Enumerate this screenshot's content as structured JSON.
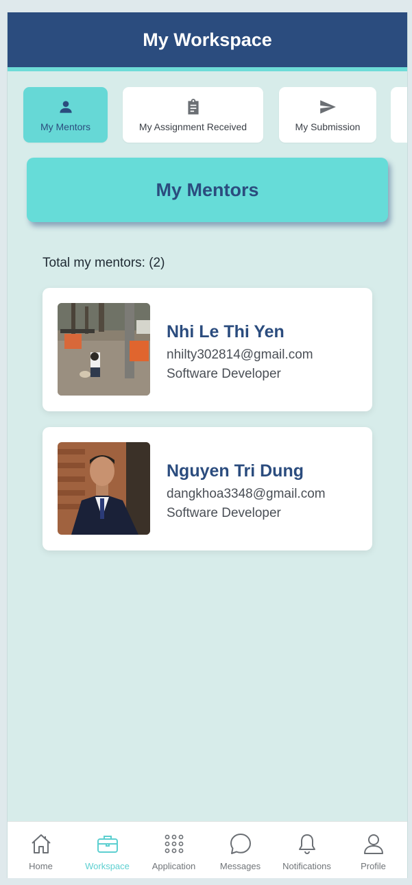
{
  "header": {
    "title": "My Workspace"
  },
  "tabs": [
    {
      "label": "My Mentors",
      "icon": "person-icon",
      "active": true
    },
    {
      "label": "My Assignment Received",
      "icon": "clipboard-icon",
      "active": false
    },
    {
      "label": "My Submission",
      "icon": "send-icon",
      "active": false
    }
  ],
  "section": {
    "title": "My Mentors"
  },
  "total": {
    "text": "Total my mentors: (2)"
  },
  "mentors": [
    {
      "name": "Nhi Le Thi Yen",
      "email": "nhilty302814@gmail.com",
      "role": "Software Developer",
      "photo": "street-photo"
    },
    {
      "name": "Nguyen Tri Dung",
      "email": "dangkhoa3348@gmail.com",
      "role": "Software Developer",
      "photo": "portrait-photo"
    }
  ],
  "nav": [
    {
      "label": "Home",
      "icon": "home-icon"
    },
    {
      "label": "Workspace",
      "icon": "briefcase-icon",
      "active": true
    },
    {
      "label": "Application",
      "icon": "grid-dots-icon"
    },
    {
      "label": "Messages",
      "icon": "chat-bubble-icon"
    },
    {
      "label": "Notifications",
      "icon": "bell-icon"
    },
    {
      "label": "Profile",
      "icon": "user-icon"
    }
  ],
  "colors": {
    "primary": "#2b4c7e",
    "accent": "#66d8d6",
    "background": "#d7ecea"
  }
}
